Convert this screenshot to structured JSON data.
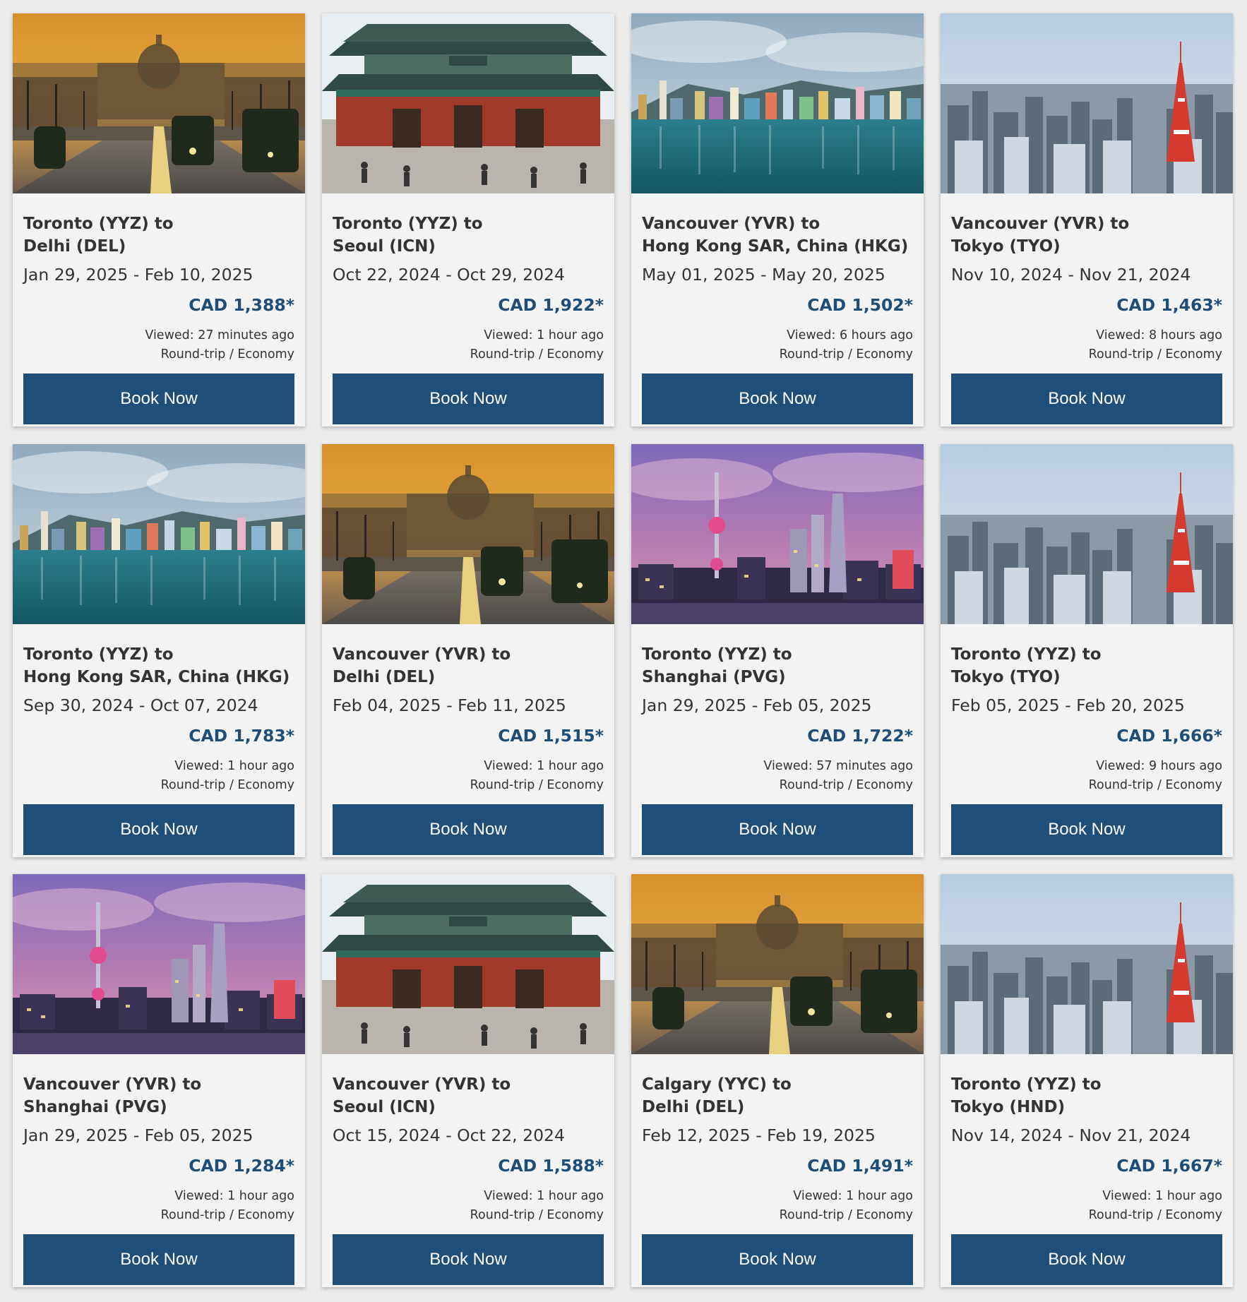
{
  "deals": [
    {
      "origin_line": "Toronto (YYZ) to",
      "destination_line": "Delhi (DEL)",
      "dates": "Jan 29, 2025 - Feb 10, 2025",
      "price": "CAD 1,388*",
      "viewed": "Viewed: 27 minutes ago",
      "fare_type": "Round-trip / Economy",
      "book_label": "Book Now",
      "image": "delhi"
    },
    {
      "origin_line": "Toronto (YYZ) to",
      "destination_line": "Seoul (ICN)",
      "dates": "Oct 22, 2024 - Oct 29, 2024",
      "price": "CAD 1,922*",
      "viewed": "Viewed: 1 hour ago",
      "fare_type": "Round-trip / Economy",
      "book_label": "Book Now",
      "image": "seoul"
    },
    {
      "origin_line": "Vancouver (YVR) to",
      "destination_line": "Hong Kong SAR, China (HKG)",
      "dates": "May 01, 2025 - May 20, 2025",
      "price": "CAD 1,502*",
      "viewed": "Viewed: 6 hours ago",
      "fare_type": "Round-trip / Economy",
      "book_label": "Book Now",
      "image": "hongkong"
    },
    {
      "origin_line": "Vancouver (YVR) to",
      "destination_line": "Tokyo (TYO)",
      "dates": "Nov 10, 2024 - Nov 21, 2024",
      "price": "CAD 1,463*",
      "viewed": "Viewed: 8 hours ago",
      "fare_type": "Round-trip / Economy",
      "book_label": "Book Now",
      "image": "tokyo"
    },
    {
      "origin_line": "Toronto (YYZ) to",
      "destination_line": "Hong Kong SAR, China (HKG)",
      "dates": "Sep 30, 2024 - Oct 07, 2024",
      "price": "CAD 1,783*",
      "viewed": "Viewed: 1 hour ago",
      "fare_type": "Round-trip / Economy",
      "book_label": "Book Now",
      "image": "hongkong"
    },
    {
      "origin_line": "Vancouver (YVR) to",
      "destination_line": "Delhi (DEL)",
      "dates": "Feb 04, 2025 - Feb 11, 2025",
      "price": "CAD 1,515*",
      "viewed": "Viewed: 1 hour ago",
      "fare_type": "Round-trip / Economy",
      "book_label": "Book Now",
      "image": "delhi"
    },
    {
      "origin_line": "Toronto (YYZ) to",
      "destination_line": "Shanghai (PVG)",
      "dates": "Jan 29, 2025 - Feb 05, 2025",
      "price": "CAD 1,722*",
      "viewed": "Viewed: 57 minutes ago",
      "fare_type": "Round-trip / Economy",
      "book_label": "Book Now",
      "image": "shanghai"
    },
    {
      "origin_line": "Toronto (YYZ) to",
      "destination_line": "Tokyo (TYO)",
      "dates": "Feb 05, 2025 - Feb 20, 2025",
      "price": "CAD 1,666*",
      "viewed": "Viewed: 9 hours ago",
      "fare_type": "Round-trip / Economy",
      "book_label": "Book Now",
      "image": "tokyo"
    },
    {
      "origin_line": "Vancouver (YVR) to",
      "destination_line": "Shanghai (PVG)",
      "dates": "Jan 29, 2025 - Feb 05, 2025",
      "price": "CAD 1,284*",
      "viewed": "Viewed: 1 hour ago",
      "fare_type": "Round-trip / Economy",
      "book_label": "Book Now",
      "image": "shanghai"
    },
    {
      "origin_line": "Vancouver (YVR) to",
      "destination_line": "Seoul (ICN)",
      "dates": "Oct 15, 2024 - Oct 22, 2024",
      "price": "CAD 1,588*",
      "viewed": "Viewed: 1 hour ago",
      "fare_type": "Round-trip / Economy",
      "book_label": "Book Now",
      "image": "seoul"
    },
    {
      "origin_line": "Calgary (YYC) to",
      "destination_line": "Delhi (DEL)",
      "dates": "Feb 12, 2025 - Feb 19, 2025",
      "price": "CAD 1,491*",
      "viewed": "Viewed: 1 hour ago",
      "fare_type": "Round-trip / Economy",
      "book_label": "Book Now",
      "image": "delhi"
    },
    {
      "origin_line": "Toronto (YYZ) to",
      "destination_line": "Tokyo (HND)",
      "dates": "Nov 14, 2024 - Nov 21, 2024",
      "price": "CAD 1,667*",
      "viewed": "Viewed: 1 hour ago",
      "fare_type": "Round-trip / Economy",
      "book_label": "Book Now",
      "image": "tokyo"
    }
  ],
  "colors": {
    "page_background": "#ececec",
    "card_background": "#f3f3f3",
    "price_color": "#1e4d78",
    "button_color": "#1f4e79",
    "button_text": "#ffffff"
  }
}
